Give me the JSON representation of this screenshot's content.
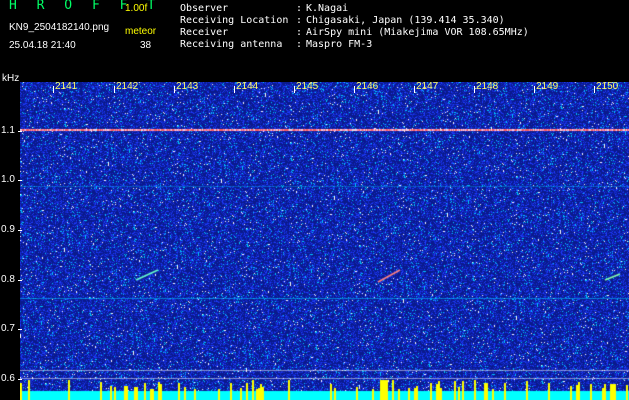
{
  "header": {
    "app_title": "H R O F F T",
    "version": "1.00f",
    "file_name": "KN9_2504182140.png",
    "mode": "meteor",
    "datetime": "25.04.18 21:40",
    "count": "38"
  },
  "station_info": [
    {
      "key": "Observer",
      "value": "K.Nagai"
    },
    {
      "key": "Receiving Location",
      "value": "Chigasaki, Japan (139.414 35.340)"
    },
    {
      "key": "Receiver",
      "value": "AirSpy mini (Miakejima VOR 108.65MHz)"
    },
    {
      "key": "Receiving antenna",
      "value": "Maspro FM-3"
    }
  ],
  "separator": ":",
  "spectrogram": {
    "unit_label": "kHz",
    "y_ticks": [
      "1.1",
      "1.0",
      "0.9",
      "0.8",
      "0.7",
      "0.6"
    ],
    "x_ticks": [
      "2141",
      "2142",
      "2143",
      "2144",
      "2145",
      "2146",
      "2147",
      "2148",
      "2149",
      "2150"
    ],
    "colors": {
      "background": "#0a1a8c",
      "noise_low": "#1f3cff",
      "noise_mid": "#00c8ff",
      "noise_high": "#ffffff",
      "carrier": "#ff6060",
      "bottom_band": "#00ffff",
      "peaks": "#ffff00"
    }
  }
}
